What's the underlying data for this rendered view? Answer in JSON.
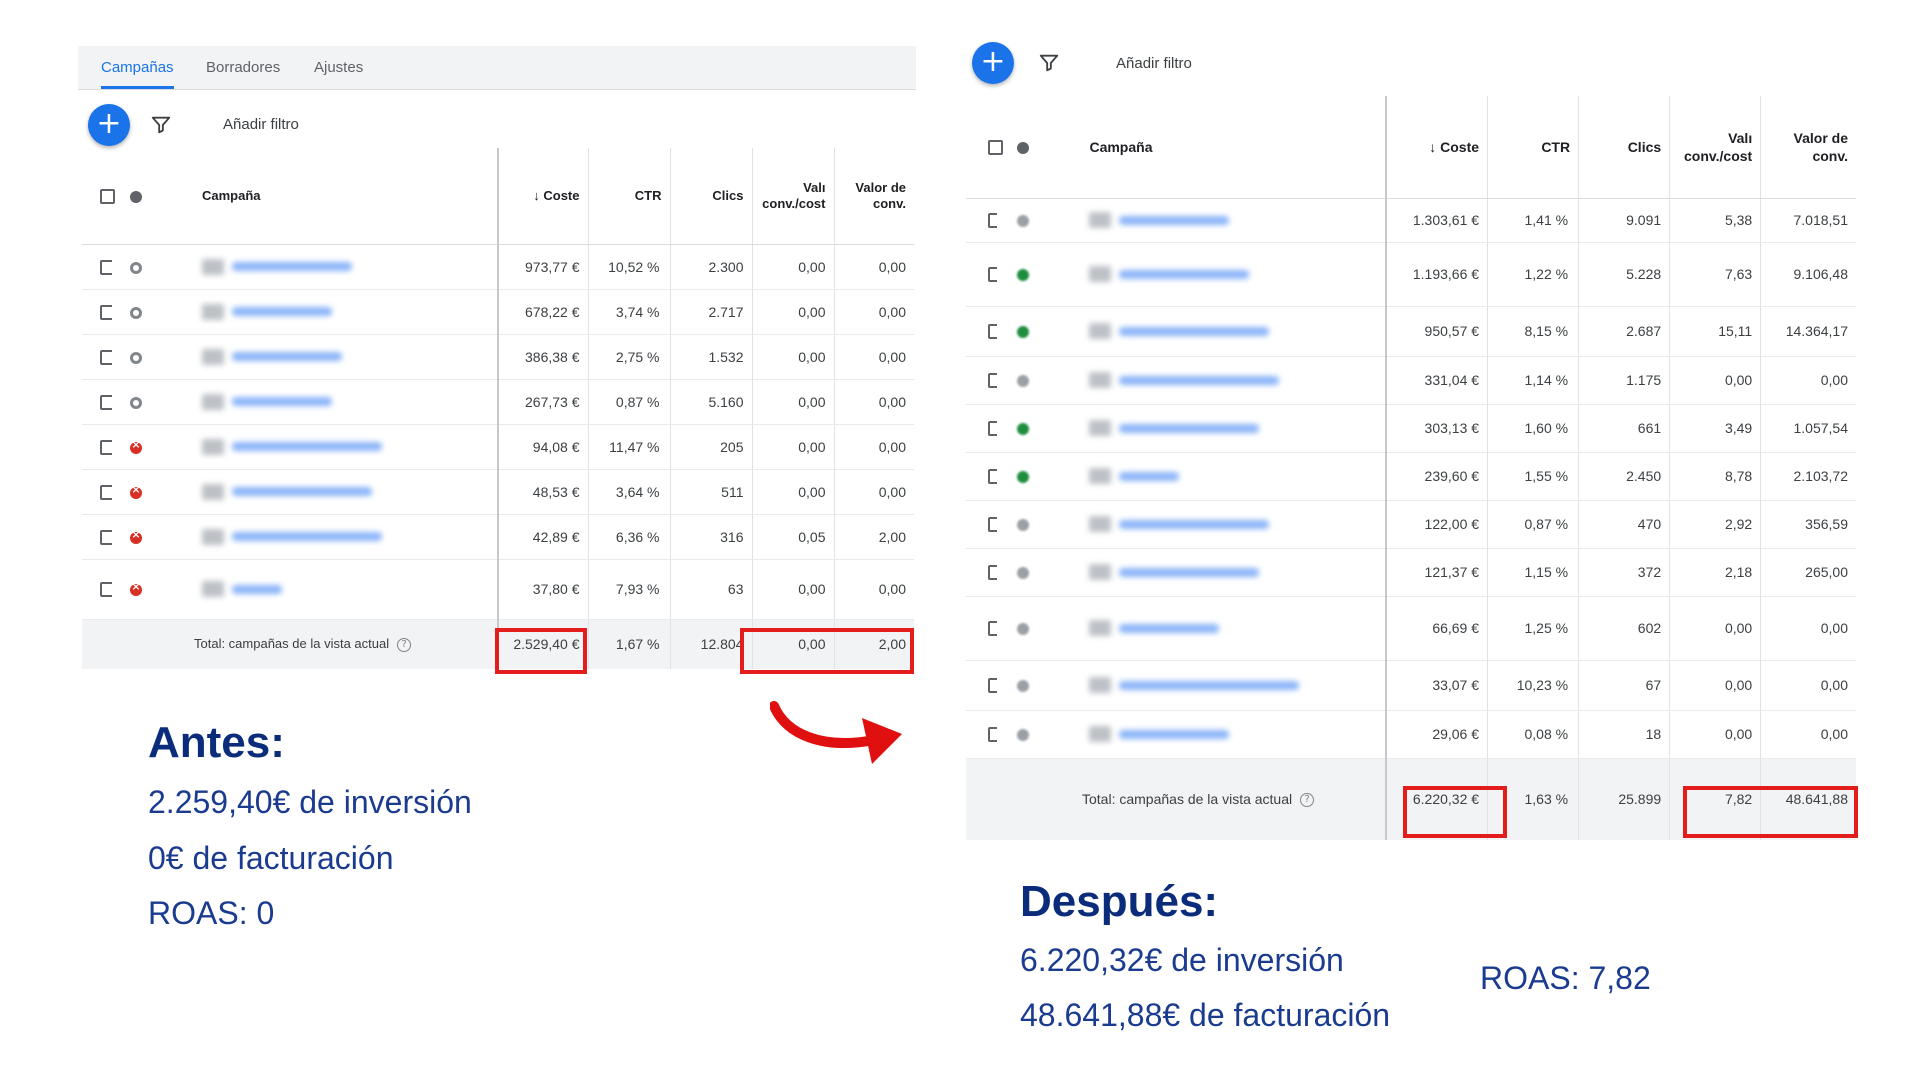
{
  "before": {
    "tabs": [
      "Campañas",
      "Borradores",
      "Ajustes"
    ],
    "add_filter_label": "Añadir filtro",
    "columns": {
      "campaign": "Campaña",
      "cost": "↓ Coste",
      "ctr": "CTR",
      "clicks": "Clics",
      "conv_value_cost_1": "Valı",
      "conv_value_cost_2": "conv./cost",
      "conv_value_1": "Valor de",
      "conv_value_2": "conv."
    },
    "rows": [
      {
        "status": "paused",
        "cost": "973,77 €",
        "ctr": "10,52 %",
        "clicks": "2.300",
        "value_cost": "0,00",
        "value": "0,00"
      },
      {
        "status": "paused",
        "cost": "678,22 €",
        "ctr": "3,74 %",
        "clicks": "2.717",
        "value_cost": "0,00",
        "value": "0,00"
      },
      {
        "status": "paused",
        "cost": "386,38 €",
        "ctr": "2,75 %",
        "clicks": "1.532",
        "value_cost": "0,00",
        "value": "0,00"
      },
      {
        "status": "paused",
        "cost": "267,73 €",
        "ctr": "0,87 %",
        "clicks": "5.160",
        "value_cost": "0,00",
        "value": "0,00"
      },
      {
        "status": "removed",
        "cost": "94,08 €",
        "ctr": "11,47 %",
        "clicks": "205",
        "value_cost": "0,00",
        "value": "0,00"
      },
      {
        "status": "removed",
        "cost": "48,53 €",
        "ctr": "3,64 %",
        "clicks": "511",
        "value_cost": "0,00",
        "value": "0,00"
      },
      {
        "status": "removed",
        "cost": "42,89 €",
        "ctr": "6,36 %",
        "clicks": "316",
        "value_cost": "0,05",
        "value": "2,00"
      },
      {
        "status": "removed",
        "cost": "37,80 €",
        "ctr": "7,93 %",
        "clicks": "63",
        "value_cost": "0,00",
        "value": "0,00"
      }
    ],
    "total": {
      "label": "Total: campañas de la vista actual",
      "help": "?",
      "cost": "2.529,40 €",
      "ctr": "1,67 %",
      "clicks": "12.804",
      "value_cost": "0,00",
      "value": "2,00"
    }
  },
  "after": {
    "add_filter_label": "Añadir filtro",
    "columns": {
      "campaign": "Campaña",
      "cost": "↓ Coste",
      "ctr": "CTR",
      "clicks": "Clics",
      "conv_value_cost_1": "Valı",
      "conv_value_cost_2": "conv./cost",
      "conv_value_1": "Valor de",
      "conv_value_2": "conv."
    },
    "rows": [
      {
        "status": "grey",
        "cost": "1.303,61 €",
        "ctr": "1,41 %",
        "clicks": "9.091",
        "value_cost": "5,38",
        "value": "7.018,51"
      },
      {
        "status": "active",
        "cost": "1.193,66 €",
        "ctr": "1,22 %",
        "clicks": "5.228",
        "value_cost": "7,63",
        "value": "9.106,48"
      },
      {
        "status": "active",
        "cost": "950,57 €",
        "ctr": "8,15 %",
        "clicks": "2.687",
        "value_cost": "15,11",
        "value": "14.364,17"
      },
      {
        "status": "grey",
        "cost": "331,04 €",
        "ctr": "1,14 %",
        "clicks": "1.175",
        "value_cost": "0,00",
        "value": "0,00"
      },
      {
        "status": "active",
        "cost": "303,13 €",
        "ctr": "1,60 %",
        "clicks": "661",
        "value_cost": "3,49",
        "value": "1.057,54"
      },
      {
        "status": "active",
        "cost": "239,60 €",
        "ctr": "1,55 %",
        "clicks": "2.450",
        "value_cost": "8,78",
        "value": "2.103,72"
      },
      {
        "status": "grey",
        "cost": "122,00 €",
        "ctr": "0,87 %",
        "clicks": "470",
        "value_cost": "2,92",
        "value": "356,59"
      },
      {
        "status": "grey",
        "cost": "121,37 €",
        "ctr": "1,15 %",
        "clicks": "372",
        "value_cost": "2,18",
        "value": "265,00"
      },
      {
        "status": "grey",
        "cost": "66,69 €",
        "ctr": "1,25 %",
        "clicks": "602",
        "value_cost": "0,00",
        "value": "0,00"
      },
      {
        "status": "grey",
        "cost": "33,07 €",
        "ctr": "10,23 %",
        "clicks": "67",
        "value_cost": "0,00",
        "value": "0,00"
      },
      {
        "status": "grey",
        "cost": "29,06 €",
        "ctr": "0,08 %",
        "clicks": "18",
        "value_cost": "0,00",
        "value": "0,00"
      }
    ],
    "total": {
      "label": "Total: campañas de la vista actual",
      "help": "?",
      "cost": "6.220,32 €",
      "ctr": "1,63 %",
      "clicks": "25.899",
      "value_cost": "7,82",
      "value": "48.641,88"
    }
  },
  "summary_before": {
    "title": "Antes:",
    "investment": "2.259,40€ de inversión",
    "revenue": "0€ de facturación",
    "roas": "ROAS: 0"
  },
  "summary_after": {
    "title": "Después:",
    "investment": "6.220,32€ de inversión",
    "revenue": "48.641,88€ de facturación",
    "roas": "ROAS: 7,82"
  },
  "colors": {
    "accent": "#1a73e8",
    "highlight": "#e31c1c",
    "summary_text": "#1a3b8f"
  }
}
